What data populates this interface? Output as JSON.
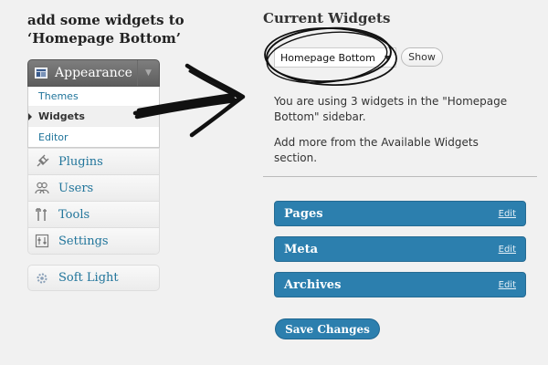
{
  "heading": {
    "line1": "add some widgets to",
    "line2": "‘Homepage Bottom’"
  },
  "appearance": {
    "label": "Appearance",
    "icon": "appearance-icon",
    "submenu": [
      {
        "label": "Themes",
        "current": false
      },
      {
        "label": "Widgets",
        "current": true
      },
      {
        "label": "Editor",
        "current": false
      }
    ]
  },
  "menu": [
    {
      "label": "Plugins",
      "icon": "plug-icon"
    },
    {
      "label": "Users",
      "icon": "users-icon"
    },
    {
      "label": "Tools",
      "icon": "tools-icon"
    },
    {
      "label": "Settings",
      "icon": "settings-icon"
    }
  ],
  "soft_light": {
    "label": "Soft Light",
    "icon": "gear-icon"
  },
  "current_widgets": {
    "title": "Current Widgets",
    "sidebar_select": "Homepage Bottom",
    "show_button": "Show",
    "info1": "You are using 3 widgets in the \"Homepage Bottom\" sidebar.",
    "info2": "Add more from the Available Widgets section."
  },
  "widgets": [
    {
      "name": "Pages",
      "edit": "Edit"
    },
    {
      "name": "Meta",
      "edit": "Edit"
    },
    {
      "name": "Archives",
      "edit": "Edit"
    }
  ],
  "save_button": "Save Changes",
  "colors": {
    "accent": "#2c7fae",
    "link": "#21759b",
    "menu_head": "#6b6b6b",
    "background": "#f1f1f1"
  }
}
